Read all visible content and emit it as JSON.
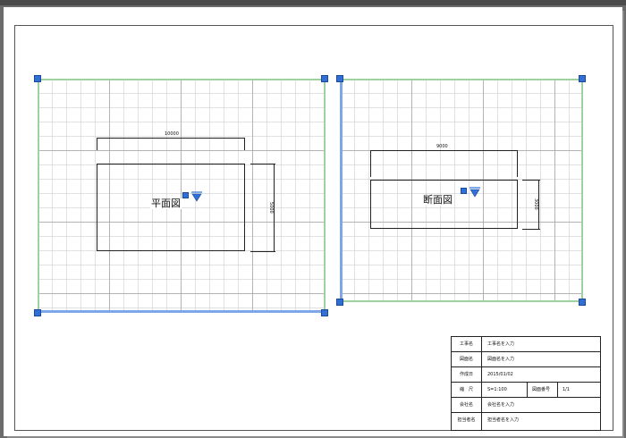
{
  "left_view": {
    "label": "平面図",
    "dim_horizontal": "10000",
    "dim_vertical": "5000"
  },
  "right_view": {
    "label": "断面図",
    "dim_horizontal": "9000",
    "dim_vertical": "3000"
  },
  "title_block": {
    "rows": [
      {
        "label": "工事名",
        "value": "工事名を入力"
      },
      {
        "label": "図面名",
        "value": "図面名を入力"
      },
      {
        "label": "作成日",
        "value": "2015/01/02"
      },
      {
        "label": "縮　尺",
        "value": "S=1:100",
        "sub_label": "図面番号",
        "sub_value": "1/1"
      },
      {
        "label": "会社名",
        "value": "会社名を入力"
      },
      {
        "label": "担当者名",
        "value": "担当者名を入力"
      }
    ]
  },
  "colors": {
    "handle": "#2f6fd6",
    "viewport_edge_green": "#9fd09f",
    "viewport_edge_blue": "#7da7e8"
  }
}
